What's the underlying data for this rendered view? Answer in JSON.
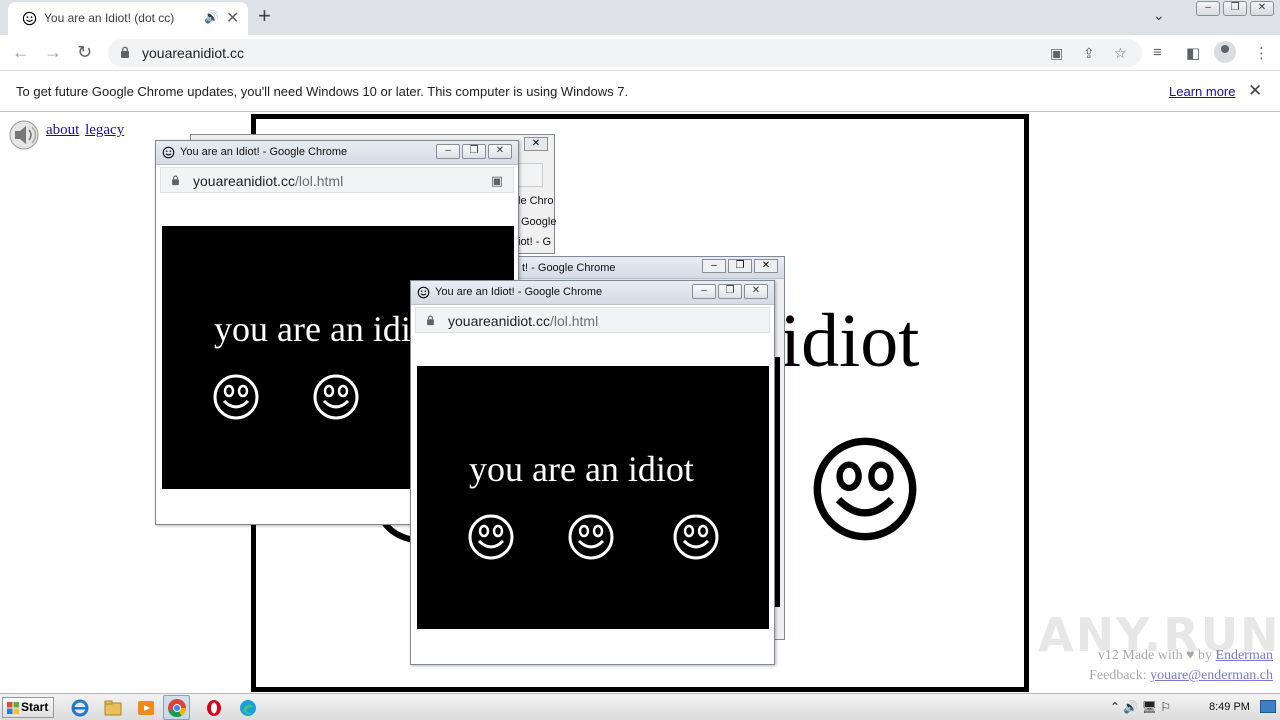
{
  "browser": {
    "tab": {
      "title": "You are an Idiot! (dot cc)",
      "audio_icon": "🔊",
      "close": "✕"
    },
    "new_tab": "+",
    "tab_search": "⌄",
    "window_buttons": [
      "–",
      "❐",
      "✕"
    ],
    "url": "youareanidiot.cc",
    "nav": {
      "back": "←",
      "forward": "→",
      "reload": "↻"
    },
    "infobar": {
      "message": "To get future Google Chrome updates, you'll need Windows 10 or later. This computer is using Windows 7.",
      "link": "Learn more",
      "close": "✕"
    }
  },
  "page": {
    "links": [
      "about",
      "legacy"
    ],
    "big_text": "idiot",
    "credits": {
      "made_with": "v12 Made with ♥ by",
      "author": "Enderman",
      "feedback_label": "Feedback:",
      "email": "youare@enderman.ch"
    },
    "watermark": "ANY.RUN"
  },
  "popups": [
    {
      "title": "You are an Idiot! - Google Chrome",
      "url_domain": "youareanidiot.cc",
      "url_path": "/lol.html",
      "text": "you are an idiot"
    },
    {
      "title": "You are an Idiot! - Google Chrome",
      "url_domain": "youareanidiot.cc",
      "url_path": "/lol.html",
      "text": "you are an idiot"
    }
  ],
  "behind_popups": {
    "fragment1": "le Chro",
    "fragment2": "Google",
    "fragment3": "iot! - G",
    "title_partial": "t! - Google Chrome"
  },
  "taskbar": {
    "start": "Start",
    "clock": "8:49 PM",
    "tray": "⌃  🔊  🖥  ⚐"
  }
}
